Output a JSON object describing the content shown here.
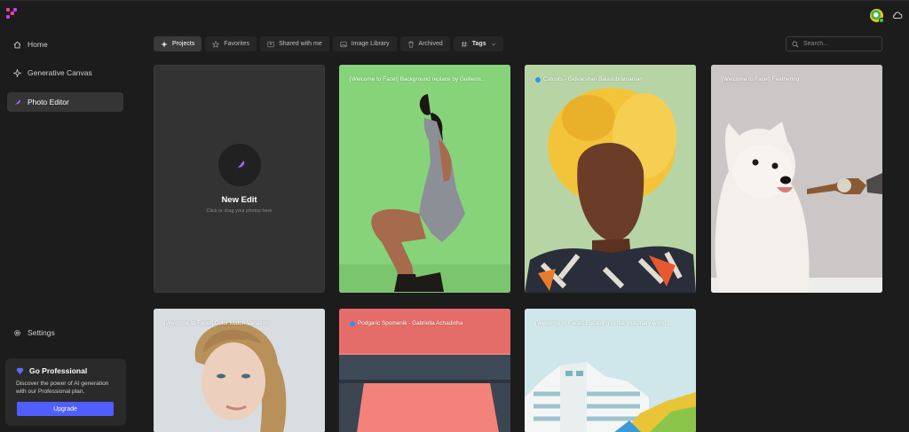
{
  "sidebar": {
    "items": [
      {
        "label": "Home",
        "icon": "home-icon"
      },
      {
        "label": "Generative Canvas",
        "icon": "sparkle-icon"
      },
      {
        "label": "Photo Editor",
        "icon": "feather-icon",
        "active": true
      },
      {
        "label": "Settings",
        "icon": "gear-icon"
      }
    ],
    "promo": {
      "title": "Go Professional",
      "description": "Discover the power of AI generation with our Professional plan.",
      "button": "Upgrade"
    }
  },
  "toolbar": {
    "tabs": [
      {
        "label": "Projects",
        "icon": "sparkle-icon",
        "active": true
      },
      {
        "label": "Favorites",
        "icon": "star-icon"
      },
      {
        "label": "Shared with me",
        "icon": "users-icon"
      },
      {
        "label": "Image Library",
        "icon": "image-icon"
      },
      {
        "label": "Archived",
        "icon": "trash-icon"
      },
      {
        "label": "Tags",
        "icon": "hash-icon"
      }
    ],
    "search_placeholder": "Search..."
  },
  "new_edit": {
    "title": "New Edit",
    "subtitle": "Click or drag your photos here"
  },
  "projects": [
    {
      "title": "[Welcome to Facet] Background replace by Guillerm...",
      "shared": false
    },
    {
      "title": "Cutouts - Gidvarshan Balasubramanian",
      "shared": true
    },
    {
      "title": "[Welcome to Facet] Feathering",
      "shared": false
    },
    {
      "title": "[Welcome to Facet] Color Match Variation",
      "shared": false
    },
    {
      "title": "Podgaric Spomenik - Gabriella Achadinha",
      "shared": true
    },
    {
      "title": "[Welcome to Facet] Escaping to the imaginary world ...",
      "shared": false
    }
  ],
  "colors": {
    "accent": "#4f5fff",
    "background": "#1c1c1c",
    "sidebar_active": "#353535"
  }
}
